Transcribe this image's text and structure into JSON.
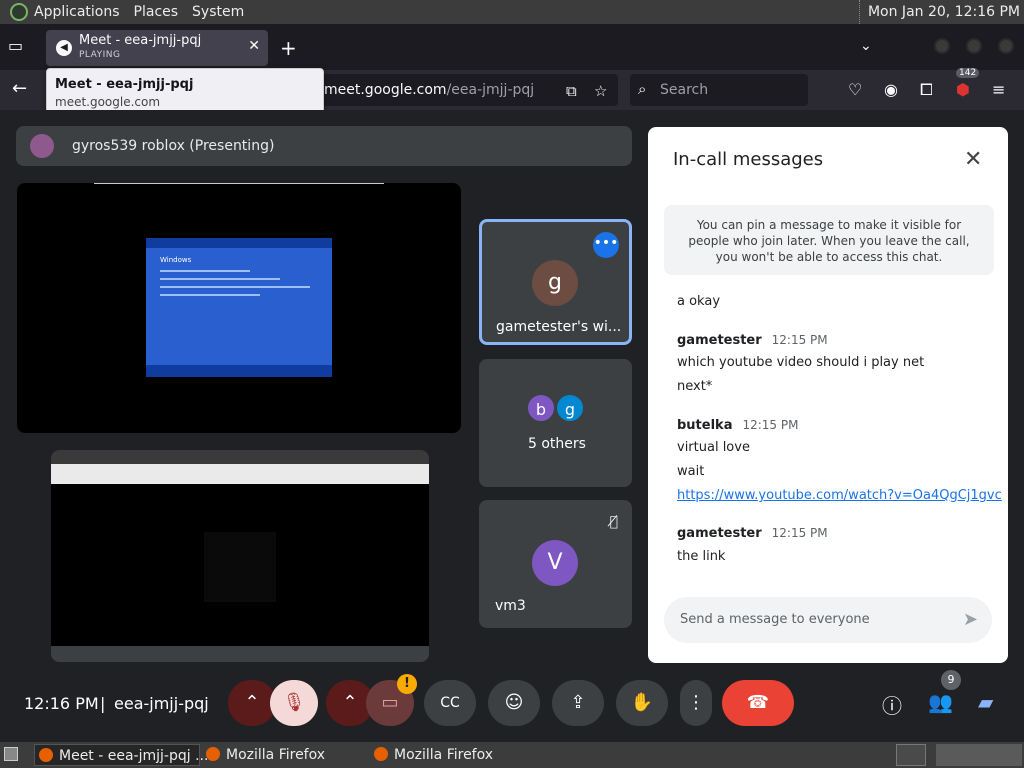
{
  "gnome_panel": {
    "menus": [
      "Applications",
      "Places",
      "System"
    ],
    "clock": "Mon Jan 20, 12:16 PM"
  },
  "browser": {
    "tab": {
      "title": "Meet - eea-jmjj-pqj",
      "status": "PLAYING"
    },
    "tooltip": {
      "title": "Meet - eea-jmjj-pqj",
      "host": "meet.google.com"
    },
    "url_prefix": "",
    "url_host": "meet.google.com",
    "url_path": "/eea-jmjj-pqj",
    "search_placeholder": "Search",
    "extension_badge": "142"
  },
  "meet": {
    "presenter_label": "gyros539 roblox (Presenting)",
    "screen_xp_text": "Windows",
    "tiles": [
      {
        "letter": "g",
        "name": "gametester's wi...",
        "color": "#6d4c41"
      },
      {
        "letters": [
          "b",
          "g"
        ],
        "name": "5 others",
        "colors": [
          "#7e57c2",
          "#0288d1"
        ]
      },
      {
        "letter": "V",
        "name": "vm3",
        "color": "#7e57c2"
      }
    ],
    "chat": {
      "title": "In-call messages",
      "pin_notice": "You can pin a message to make it visible for people who join later. When you leave the call, you won't be able to access this chat.",
      "messages": [
        {
          "text": "a okay"
        },
        {
          "sender": "gametester",
          "time": "12:15 PM",
          "lines": [
            "which youtube video should i play net",
            "next*"
          ]
        },
        {
          "sender": "butelka",
          "time": "12:15 PM",
          "lines": [
            "virtual love",
            "wait",
            "https://www.youtube.com/watch?v=Oa4QgCj1gvc"
          ]
        },
        {
          "sender": "gametester",
          "time": "12:15 PM",
          "lines": [
            "the link"
          ]
        }
      ],
      "input_placeholder": "Send a message to everyone"
    },
    "bottom": {
      "time": "12:16 PM",
      "separator": "|",
      "meeting_code": "eea-jmjj-pqj",
      "warning_badge": "!",
      "people_count": "9"
    }
  },
  "taskbar": {
    "items": [
      "Meet - eea-jmjj-pqj ...",
      "Mozilla Firefox",
      "Mozilla Firefox"
    ]
  },
  "colors": {
    "accent": "#1a73e8",
    "end_call": "#ea4335",
    "warning": "#f9ab00"
  }
}
